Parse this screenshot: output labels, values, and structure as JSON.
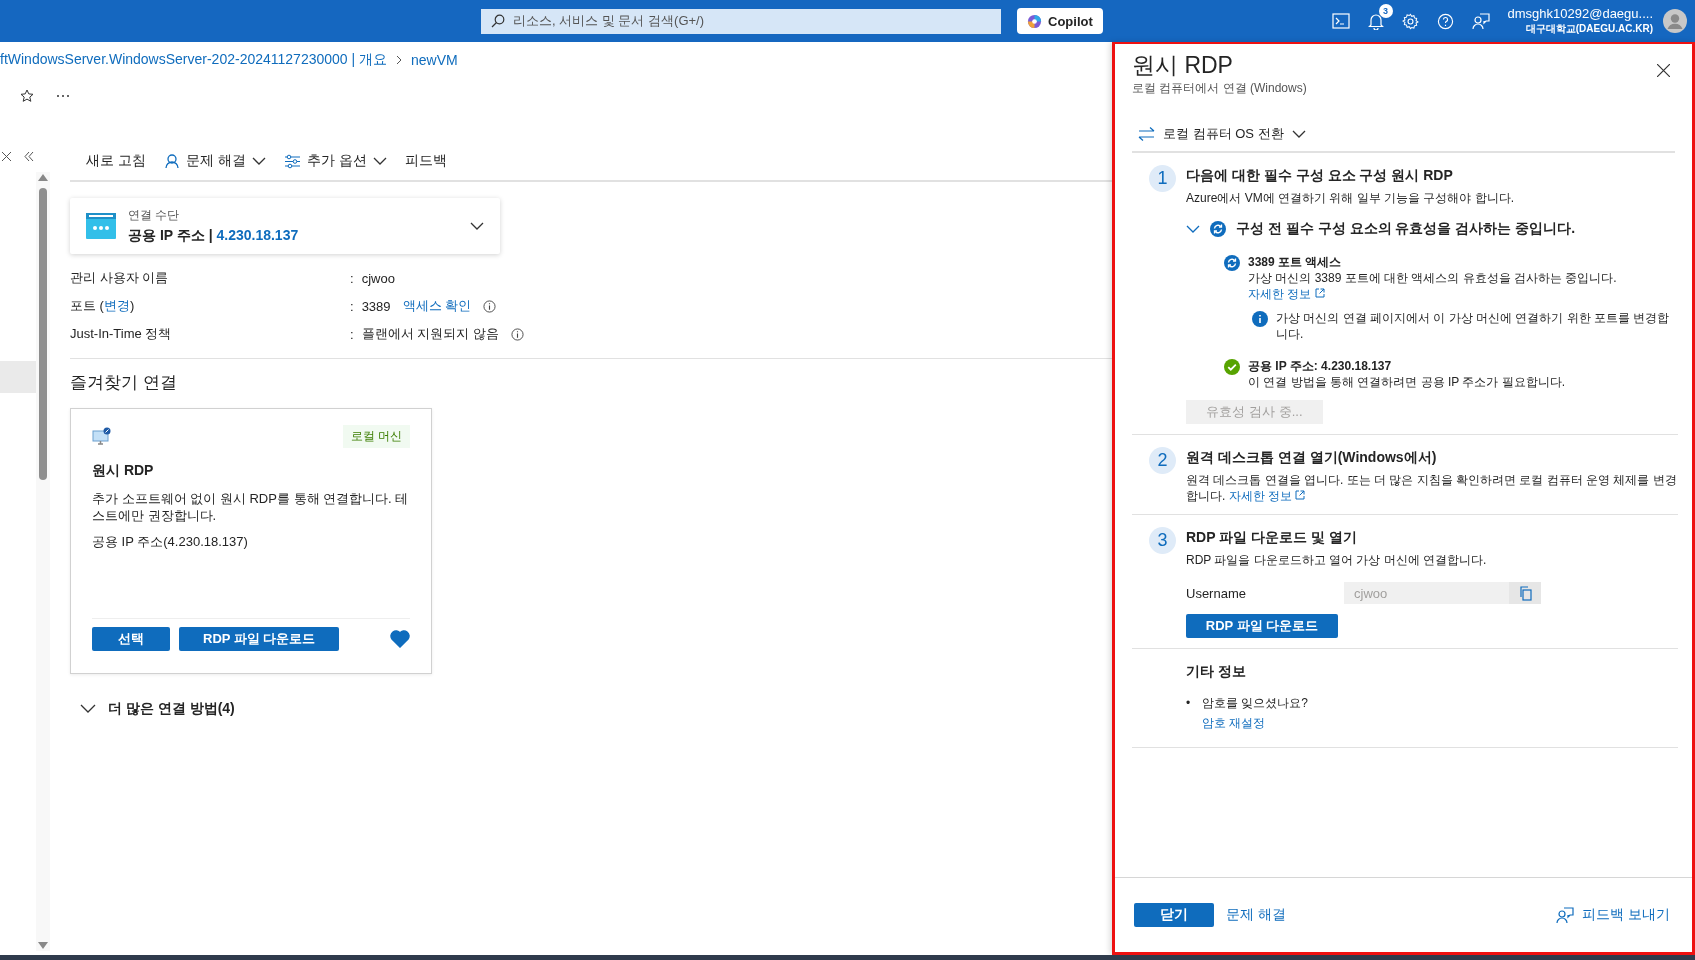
{
  "top_bar": {
    "search_placeholder": "리소스, 서비스 및 문서 검색(G+/)",
    "copilot": "Copilot",
    "notification_count": "3",
    "account_email": "dmsghk10292@daegu....",
    "account_org": "대구대학교(DAEGU.AC.KR)"
  },
  "breadcrumb": [
    {
      "label": "ftWindowsServer.WindowsServer-202-20241127230000 | 개요"
    },
    {
      "label": "newVM"
    }
  ],
  "toolbar": [
    {
      "label": "새로 고침",
      "kind": "plain"
    },
    {
      "label": "문제 해결",
      "kind": "person-menu"
    },
    {
      "label": "추가 옵션",
      "kind": "sliders-menu"
    },
    {
      "label": "피드백",
      "kind": "plain"
    }
  ],
  "connection": {
    "label": "연결 수단",
    "value": "공용 IP 주소",
    "separator": "|",
    "ip": "4.230.18.137"
  },
  "details": [
    {
      "label": "관리 사용자 이름",
      "colon": ":",
      "value": "cjwoo",
      "info": false
    },
    {
      "label": "포트 (",
      "label_link": "변경",
      "label_suffix": ")",
      "colon": ":",
      "value": "3389",
      "value_link": "액세스 확인",
      "info": true
    },
    {
      "label": "Just-In-Time 정책",
      "colon": ":",
      "value": "플랜에서 지원되지 않음",
      "info": true
    }
  ],
  "favorites": {
    "heading": "즐겨찾기 연결",
    "cards": [
      {
        "tag": "로컬 머신",
        "title": "원시 RDP",
        "description": "추가 소프트웨어 없이 원시 RDP를 통해 연결합니다. 테스트에만 권장합니다.",
        "address": "공용 IP 주소(4.230.18.137)",
        "buttons": [
          "선택",
          "RDP 파일 다운로드"
        ],
        "favorite": true
      }
    ]
  },
  "more_methods": {
    "label": "더 많은 연결 방법(4)",
    "expanded": false
  },
  "panel": {
    "title": "원시 RDP",
    "subtitle": "로컬 컴퓨터에서 연결 (Windows)",
    "os_switch": "로컬 컴퓨터 OS 전환",
    "steps": [
      {
        "number": "1",
        "title": "다음에 대한 필수 구성 요소 구성 원시 RDP",
        "description": "Azure에서 VM에 연결하기 위해 일부 기능을 구성해야 합니다.",
        "check": {
          "title": "구성 전 필수 구성 요소의 유효성을 검사하는 중입니다.",
          "expanded": true,
          "items": [
            {
              "kind": "running",
              "title": "3389 포트 액세스",
              "text": "가상 머신의 3389 포트에 대한 액세스의 유효성을 검사하는 중입니다.",
              "link": "자세한 정보",
              "note": "가상 머신의 연결 페이지에서 이 가상 머신에 연결하기 위한 포트를 변경합니다."
            },
            {
              "kind": "success",
              "title": "공용 IP 주소: 4.230.18.137",
              "text": "이 연결 방법을 통해 연결하려면 공용 IP 주소가 필요합니다."
            }
          ],
          "button": {
            "label": "유효성 검사 중...",
            "disabled": true
          }
        }
      },
      {
        "number": "2",
        "title": "원격 데스크톱 연결 열기(Windows에서)",
        "description": "원격 데스크톱 연결을 엽니다. 또는 더 많은 지침을 확인하려면 로컬 컴퓨터 운영 체제를 변경합니다.",
        "link": "자세한 정보"
      },
      {
        "number": "3",
        "title": "RDP 파일 다운로드 및 열기",
        "description": "RDP 파일을 다운로드하고 열어 가상 머신에 연결합니다.",
        "field": {
          "label": "Username",
          "value": "cjwoo"
        },
        "button": "RDP 파일 다운로드"
      }
    ],
    "other": {
      "heading": "기타 정보",
      "items": [
        {
          "marker": "•",
          "text": "암호를 잊으셨나요?",
          "link": "암호 재설정"
        }
      ]
    },
    "footer": {
      "close": "닫기",
      "troubleshoot": "문제 해결",
      "feedback": "피드백 보내기"
    }
  }
}
